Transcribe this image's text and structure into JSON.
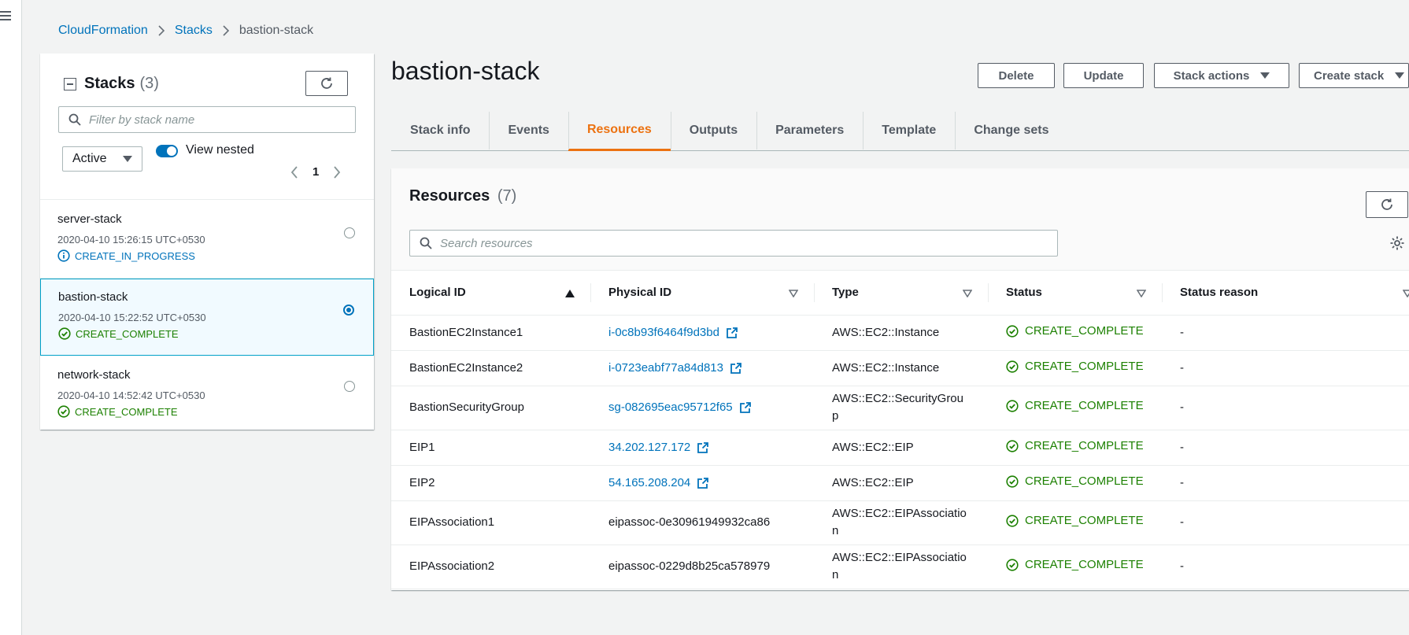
{
  "breadcrumb": {
    "items": [
      "CloudFormation",
      "Stacks"
    ],
    "current": "bastion-stack"
  },
  "stacks_panel": {
    "title": "Stacks",
    "count": "(3)",
    "filter_placeholder": "Filter by stack name",
    "status_filter": "Active",
    "toggle_label": "View nested",
    "toggle_on": true,
    "page": "1"
  },
  "stacks": [
    {
      "name": "server-stack",
      "date": "2020-04-10 15:26:15 UTC+0530",
      "status": "CREATE_IN_PROGRESS",
      "selected": false
    },
    {
      "name": "bastion-stack",
      "date": "2020-04-10 15:22:52 UTC+0530",
      "status": "CREATE_COMPLETE",
      "selected": true
    },
    {
      "name": "network-stack",
      "date": "2020-04-10 14:52:42 UTC+0530",
      "status": "CREATE_COMPLETE",
      "selected": false
    }
  ],
  "main": {
    "title": "bastion-stack",
    "actions": {
      "delete": "Delete",
      "update": "Update",
      "stack_actions": "Stack actions",
      "create_stack": "Create stack"
    },
    "tabs": [
      "Stack info",
      "Events",
      "Resources",
      "Outputs",
      "Parameters",
      "Template",
      "Change sets"
    ],
    "active_tab": "Resources"
  },
  "resources": {
    "title": "Resources",
    "count": "(7)",
    "search_placeholder": "Search resources",
    "columns": [
      "Logical ID",
      "Physical ID",
      "Type",
      "Status",
      "Status reason"
    ],
    "rows": [
      {
        "logical_id": "BastionEC2Instance1",
        "physical_id": "i-0c8b93f6464f9d3bd",
        "link": true,
        "type": "AWS::EC2::Instance",
        "status": "CREATE_COMPLETE",
        "reason": "-"
      },
      {
        "logical_id": "BastionEC2Instance2",
        "physical_id": "i-0723eabf77a84d813",
        "link": true,
        "type": "AWS::EC2::Instance",
        "status": "CREATE_COMPLETE",
        "reason": "-"
      },
      {
        "logical_id": "BastionSecurityGroup",
        "physical_id": "sg-082695eac95712f65",
        "link": true,
        "type": "AWS::EC2::SecurityGroup",
        "status": "CREATE_COMPLETE",
        "reason": "-"
      },
      {
        "logical_id": "EIP1",
        "physical_id": "34.202.127.172",
        "link": true,
        "type": "AWS::EC2::EIP",
        "status": "CREATE_COMPLETE",
        "reason": "-"
      },
      {
        "logical_id": "EIP2",
        "physical_id": "54.165.208.204",
        "link": true,
        "type": "AWS::EC2::EIP",
        "status": "CREATE_COMPLETE",
        "reason": "-"
      },
      {
        "logical_id": "EIPAssociation1",
        "physical_id": "eipassoc-0e30961949932ca86",
        "link": false,
        "type": "AWS::EC2::EIPAssociation",
        "status": "CREATE_COMPLETE",
        "reason": "-"
      },
      {
        "logical_id": "EIPAssociation2",
        "physical_id": "eipassoc-0229d8b25ca578979",
        "link": false,
        "type": "AWS::EC2::EIPAssociation",
        "status": "CREATE_COMPLETE",
        "reason": "-"
      }
    ]
  },
  "colors": {
    "link": "#0073bb",
    "accent": "#ec7211",
    "success": "#1d8102",
    "info": "#0073bb"
  }
}
